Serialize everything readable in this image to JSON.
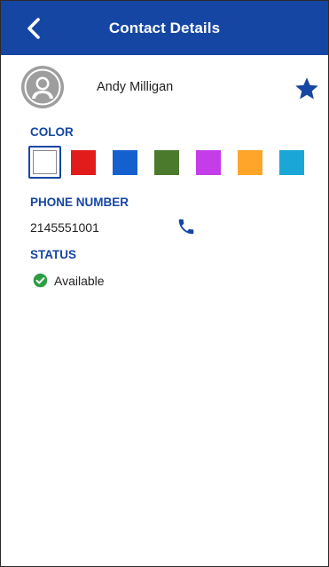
{
  "app_bar": {
    "title": "Contact Details",
    "back_icon": "chevron-left-icon",
    "background_color": "#1646a3"
  },
  "contact": {
    "name": "Andy Milligan",
    "avatar_icon": "person-avatar-icon",
    "favorite_icon": "star-icon",
    "favorite": true
  },
  "color": {
    "label": "COLOR",
    "options": [
      {
        "name": "white",
        "hex": "#ffffff",
        "selected": true
      },
      {
        "name": "red",
        "hex": "#e21b1b",
        "selected": false
      },
      {
        "name": "blue",
        "hex": "#1560cf",
        "selected": false
      },
      {
        "name": "green",
        "hex": "#4c7a2c",
        "selected": false
      },
      {
        "name": "purple",
        "hex": "#c43de8",
        "selected": false
      },
      {
        "name": "orange",
        "hex": "#ffa52a",
        "selected": false
      },
      {
        "name": "cyan",
        "hex": "#1aa7d7",
        "selected": false
      }
    ]
  },
  "phone": {
    "label": "PHONE NUMBER",
    "number": "2145551001",
    "call_icon": "phone-icon"
  },
  "status": {
    "label": "STATUS",
    "value": "Available",
    "icon": "check-circle-icon",
    "icon_color": "#2e9e45"
  },
  "theme": {
    "accent": "#1646a3"
  }
}
